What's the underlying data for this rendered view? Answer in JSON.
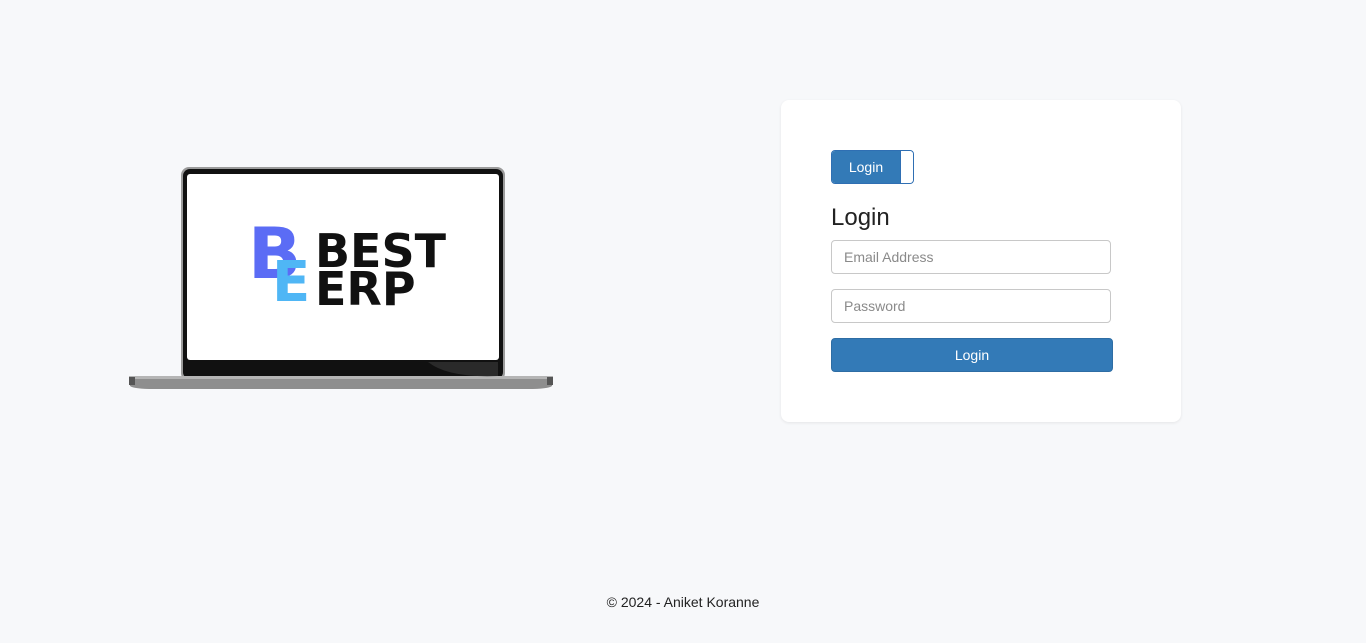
{
  "brand": {
    "logo_text_line1": "BEST",
    "logo_text_line2": "ERP",
    "logo_mark_letters": "BE",
    "colors": {
      "b_letter": "#5b6cf5",
      "e_letter": "#4fb6f5"
    }
  },
  "login_card": {
    "toggle_label": "Login",
    "title": "Login",
    "email_placeholder": "Email Address",
    "password_placeholder": "Password",
    "submit_label": "Login",
    "accent_color": "#337ab7"
  },
  "footer": {
    "text": "© 2024 - Aniket Koranne"
  }
}
